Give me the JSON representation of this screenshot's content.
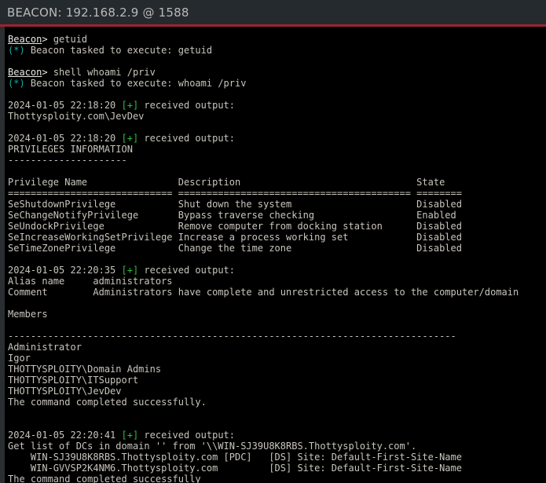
{
  "window": {
    "title": "BEACON: 192.168.2.9 @ 1588",
    "title_prefix": "BEACON:",
    "host": "192.168.2.9",
    "separator": "@",
    "pid": "1588",
    "accent_color": "#9e2233",
    "titlebar_bg": "#252a2e",
    "titlebar_fg": "#b9b9b9",
    "console_bg": "#000000",
    "console_fg": "#c9c5bd",
    "prompt_color": "#e8e8e4",
    "task_marker_color": "#16aaa8",
    "output_marker_color": "#2fbe3d"
  },
  "console": {
    "prompt_label": "Beacon",
    "prompt_suffix": ">",
    "task_marker": "(*)",
    "output_marker": "[+]",
    "lines": [
      {
        "type": "prompt",
        "name": "Beacon",
        "gt": "> ",
        "cmd": "getuid"
      },
      {
        "type": "task",
        "marker": "(*)",
        "text": " Beacon tasked to execute: getuid"
      },
      {
        "type": "blank"
      },
      {
        "type": "prompt",
        "name": "Beacon",
        "gt": "> ",
        "cmd": "shell whoami /priv"
      },
      {
        "type": "task",
        "marker": "(*)",
        "text": " Beacon tasked to execute: whoami /priv"
      },
      {
        "type": "blank"
      },
      {
        "type": "output",
        "pre": "2024-01-05 22:18:20 ",
        "marker": "[+]",
        "post": " received output:"
      },
      {
        "type": "plain",
        "text": "Thottysploity.com\\JevDev"
      },
      {
        "type": "blank"
      },
      {
        "type": "output",
        "pre": "2024-01-05 22:18:20 ",
        "marker": "[+]",
        "post": " received output:"
      },
      {
        "type": "plain",
        "text": "PRIVILEGES INFORMATION"
      },
      {
        "type": "plain",
        "text": "---------------------"
      },
      {
        "type": "blank"
      },
      {
        "type": "plain",
        "text": "Privilege Name                Description                               State"
      },
      {
        "type": "plain",
        "text": "============================= ========================================= ========"
      },
      {
        "type": "plain",
        "text": "SeShutdownPrivilege           Shut down the system                      Disabled"
      },
      {
        "type": "plain",
        "text": "SeChangeNotifyPrivilege       Bypass traverse checking                  Enabled"
      },
      {
        "type": "plain",
        "text": "SeUndockPrivilege             Remove computer from docking station      Disabled"
      },
      {
        "type": "plain",
        "text": "SeIncreaseWorkingSetPrivilege Increase a process working set            Disabled"
      },
      {
        "type": "plain",
        "text": "SeTimeZonePrivilege           Change the time zone                      Disabled"
      },
      {
        "type": "blank"
      },
      {
        "type": "output",
        "pre": "2024-01-05 22:20:35 ",
        "marker": "[+]",
        "post": " received output:"
      },
      {
        "type": "plain",
        "text": "Alias name     administrators"
      },
      {
        "type": "plain",
        "text": "Comment        Administrators have complete and unrestricted access to the computer/domain"
      },
      {
        "type": "blank"
      },
      {
        "type": "plain",
        "text": "Members"
      },
      {
        "type": "blank"
      },
      {
        "type": "plain",
        "text": "-------------------------------------------------------------------------------"
      },
      {
        "type": "plain",
        "text": "Administrator"
      },
      {
        "type": "plain",
        "text": "Igor"
      },
      {
        "type": "plain",
        "text": "THOTTYSPLOITY\\Domain Admins"
      },
      {
        "type": "plain",
        "text": "THOTTYSPLOITY\\ITSupport"
      },
      {
        "type": "plain",
        "text": "THOTTYSPLOITY\\JevDev"
      },
      {
        "type": "plain",
        "text": "The command completed successfully."
      },
      {
        "type": "blank"
      },
      {
        "type": "blank"
      },
      {
        "type": "output",
        "pre": "2024-01-05 22:20:41 ",
        "marker": "[+]",
        "post": " received output:"
      },
      {
        "type": "plain",
        "text": "Get list of DCs in domain '' from '\\\\WIN-SJ39U8K8RBS.Thottysploity.com'."
      },
      {
        "type": "plain",
        "text": "    WIN-SJ39U8K8RBS.Thottysploity.com [PDC]   [DS] Site: Default-First-Site-Name"
      },
      {
        "type": "plain",
        "text": "    WIN-GVVSP2K4NM6.Thottysploity.com         [DS] Site: Default-First-Site-Name"
      },
      {
        "type": "plain",
        "text": "The command completed successfully"
      }
    ]
  }
}
